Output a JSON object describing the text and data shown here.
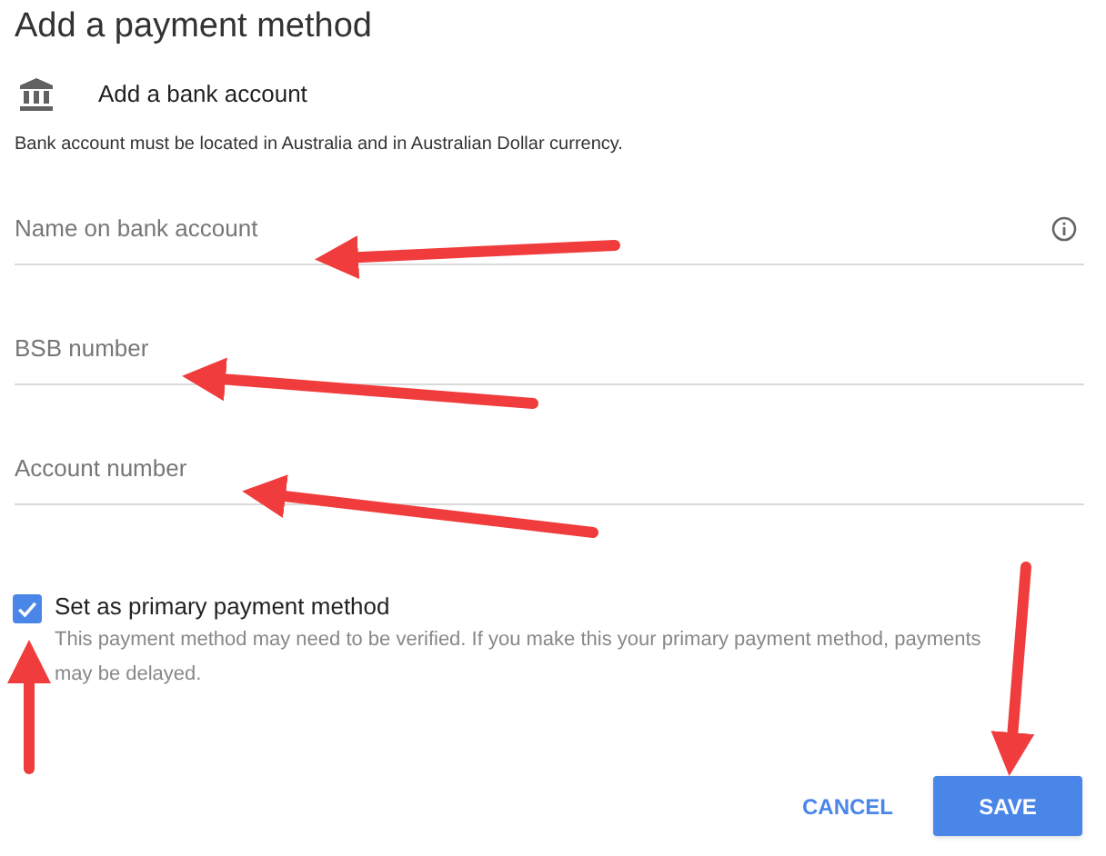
{
  "title": "Add a payment method",
  "method": {
    "label": "Add a bank account"
  },
  "note": "Bank account must be located in Australia and in Australian Dollar currency.",
  "fields": [
    {
      "placeholder": "Name on bank account",
      "info": true
    },
    {
      "placeholder": "BSB number",
      "info": false
    },
    {
      "placeholder": "Account number",
      "info": false
    }
  ],
  "primary": {
    "label": "Set as primary payment method",
    "checked": true,
    "description": "This payment method may need to be verified. If you make this your primary payment method, payments may be delayed."
  },
  "buttons": [
    {
      "label": "CANCEL",
      "kind": "text"
    },
    {
      "label": "SAVE",
      "kind": "filled"
    }
  ]
}
